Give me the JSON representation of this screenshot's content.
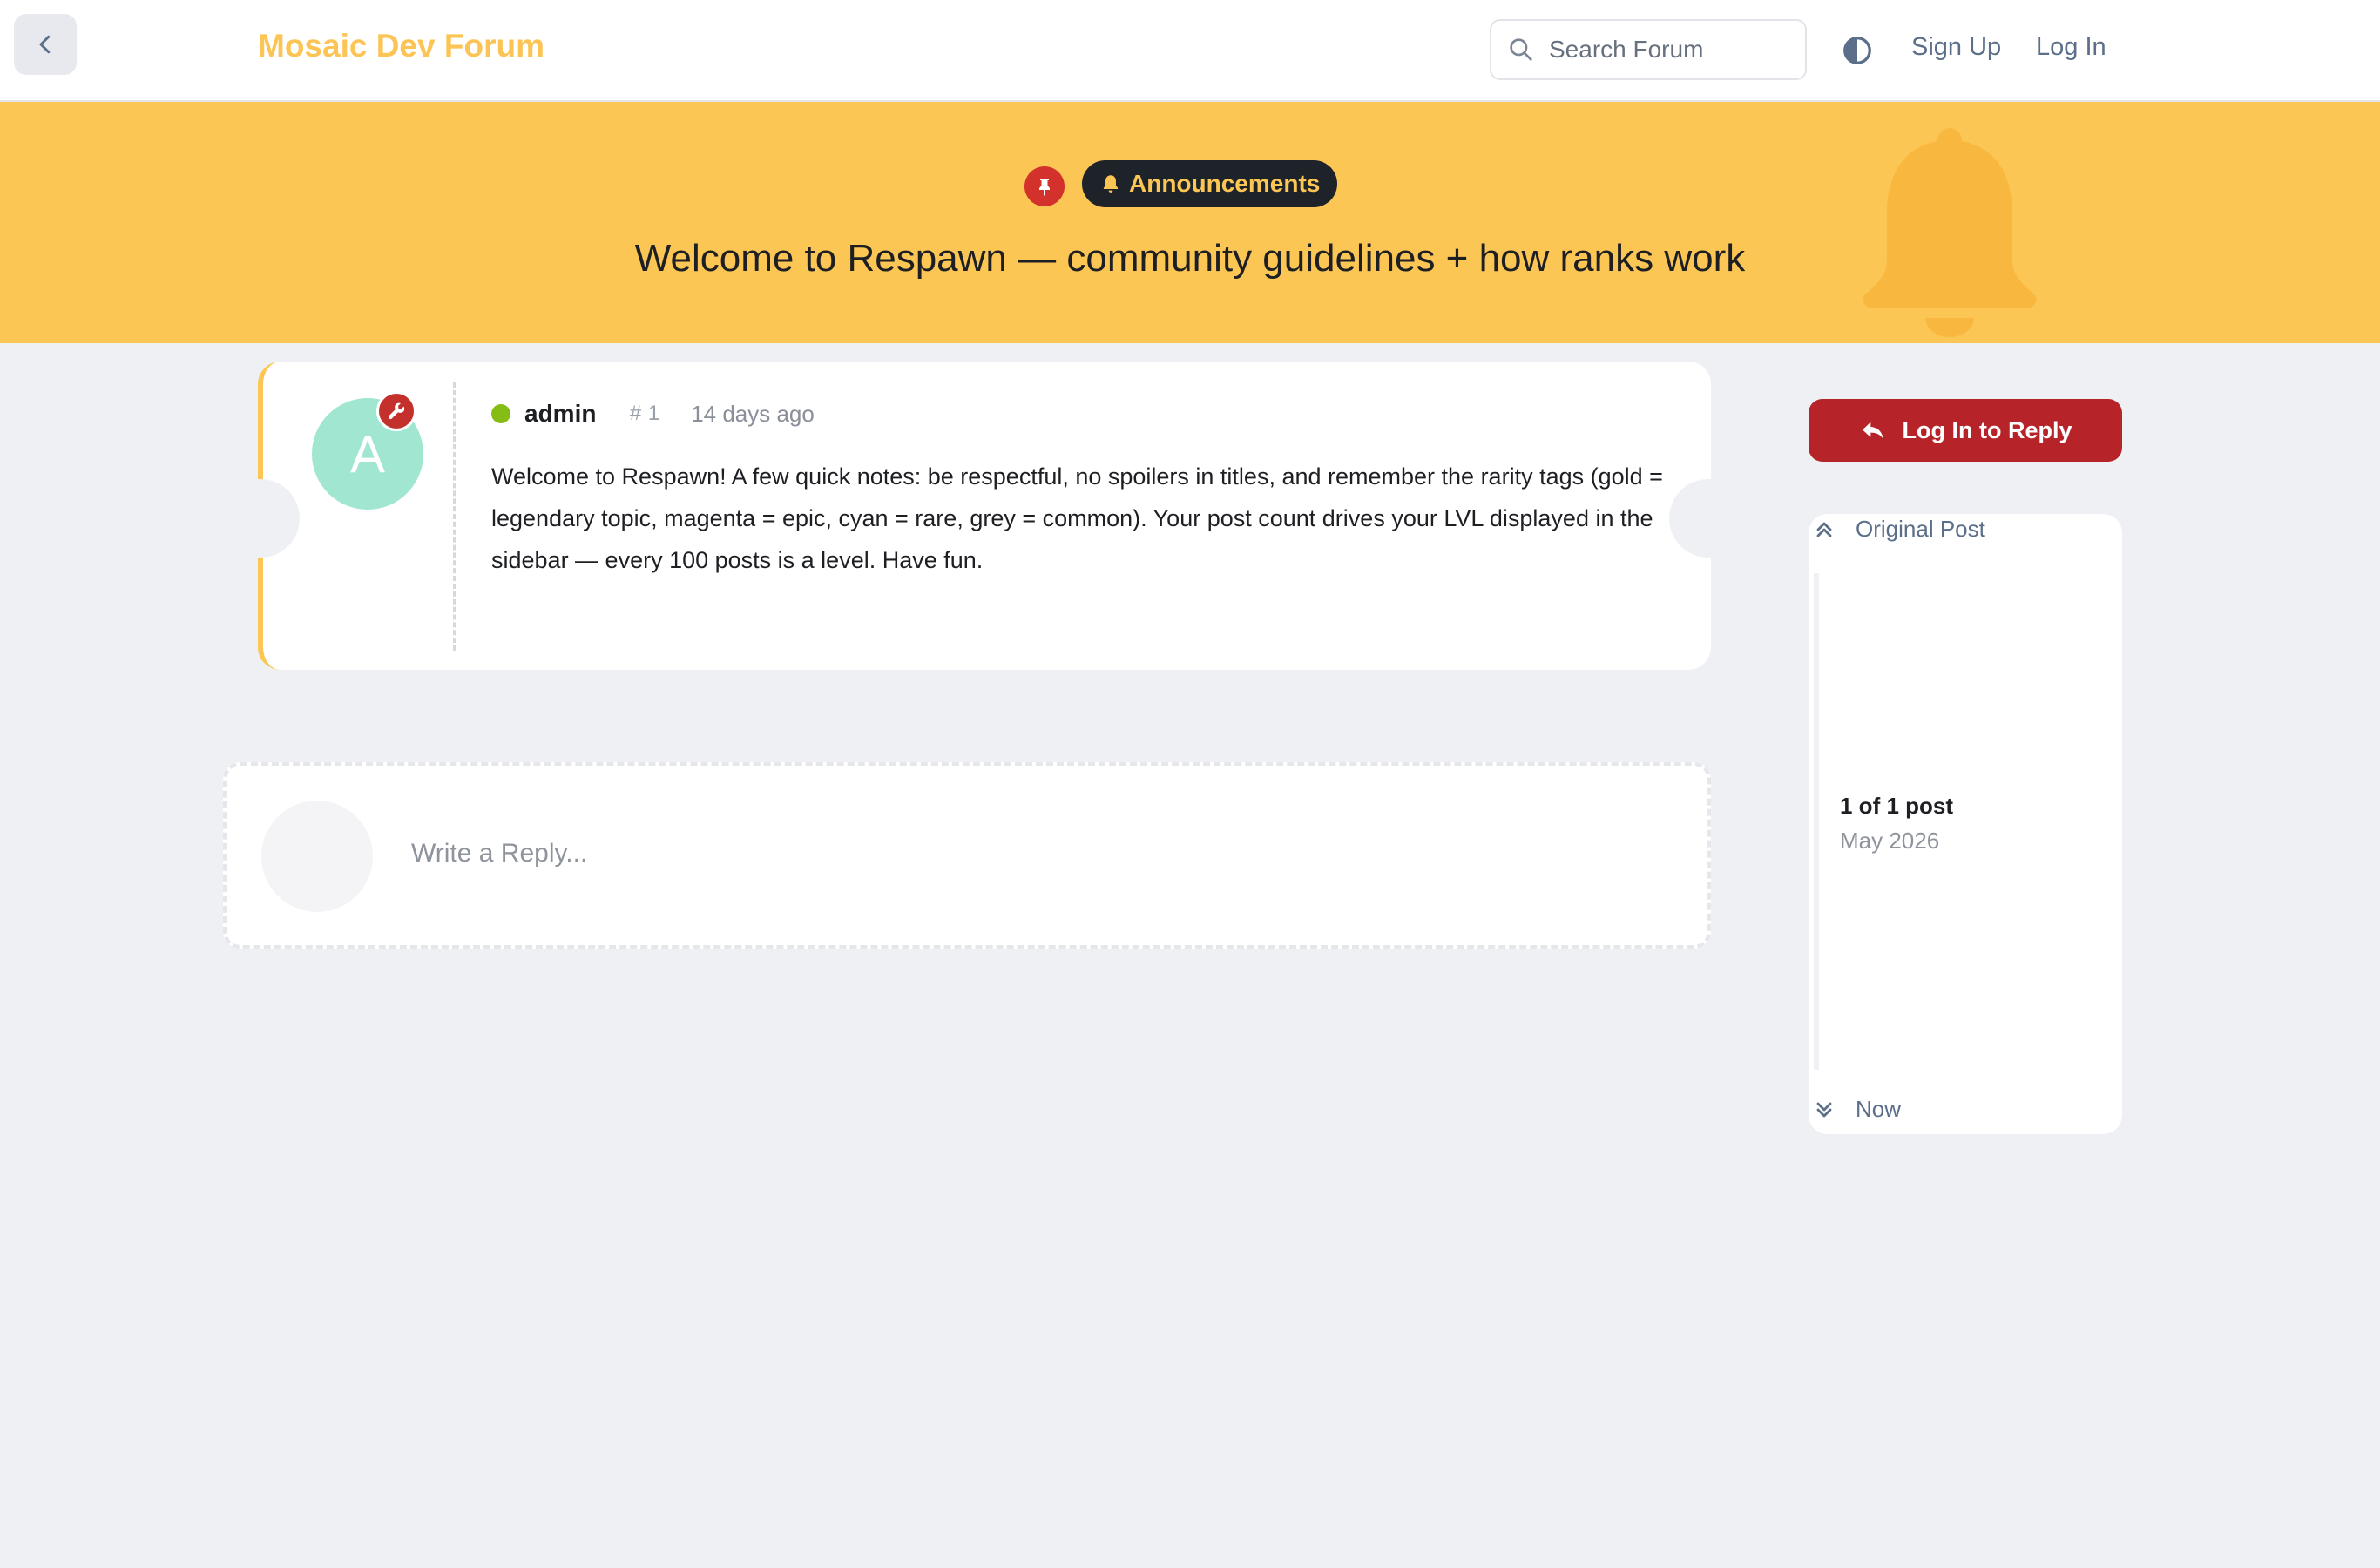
{
  "header": {
    "brand": "Mosaic Dev Forum",
    "search_placeholder": "Search Forum",
    "signup_label": "Sign Up",
    "login_label": "Log In"
  },
  "topic": {
    "category": "Announcements",
    "title": "Welcome to Respawn — community guidelines + how ranks work",
    "pinned": true
  },
  "post": {
    "avatar_letter": "A",
    "author": "admin",
    "number_hash": "#",
    "number": "1",
    "time": "14 days ago",
    "body": "Welcome to Respawn! A few quick notes: be respectful, no spoilers in titles, and remember the rarity tags (gold = legendary topic, magenta = epic, cyan = rare, grey = common). Your post count drives your LVL displayed in the sidebar — every 100 posts is a level. Have fun."
  },
  "reply": {
    "placeholder": "Write a Reply..."
  },
  "sidebar": {
    "reply_button": "Log In to Reply",
    "timeline_top": "Original Post",
    "timeline_count": "1 of 1 post",
    "timeline_date": "May 2026",
    "timeline_bottom": "Now"
  },
  "colors": {
    "accent_gold": "#fcc655",
    "brand_gold": "#fcc455",
    "reply_red": "#b62429",
    "badge_red": "#d3312c",
    "online_green": "#86bd14",
    "avatar_teal": "#a0e6d1",
    "link_slate": "#5b6f8a"
  },
  "icons": {
    "back": "chevron-left-icon",
    "search": "search-icon",
    "theme": "half-circle-theme-icon",
    "pin": "pin-icon",
    "category": "bell-icon",
    "moderator": "wrench-icon",
    "reply": "reply-arrow-icon",
    "timeline_top": "double-chevron-up-icon",
    "timeline_bottom": "double-chevron-down-icon"
  }
}
